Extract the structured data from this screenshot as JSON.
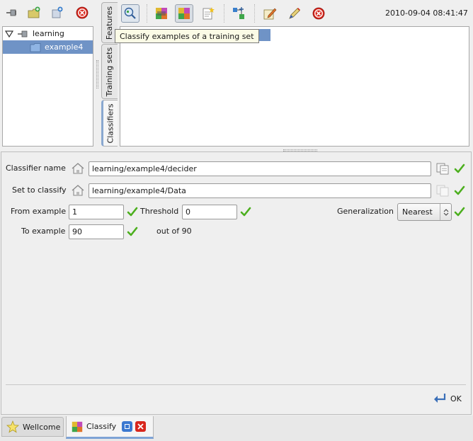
{
  "toolbar_left": {
    "icons": [
      "back-plug-icon",
      "new-folder-icon",
      "new-item-icon",
      "close-red-icon"
    ]
  },
  "tree": {
    "root_label": "learning",
    "child_label": "example4"
  },
  "vertical_tabs": {
    "features": "Features",
    "training_sets": "Training sets",
    "classifiers": "Classifiers"
  },
  "toolbar_right": {
    "timestamp": "2010-09-04 08:41:47",
    "tooltip": "Classify examples of a training set"
  },
  "form": {
    "classifier_name_label": "Classifier name",
    "classifier_name_value": "learning/example4/decider",
    "set_to_classify_label": "Set to classify",
    "set_to_classify_value": "learning/example4/Data",
    "from_example_label": "From example",
    "from_example_value": "1",
    "threshold_label": "Threshold",
    "threshold_value": "0",
    "generalization_label": "Generalization",
    "generalization_value": "Nearest",
    "to_example_label": "To example",
    "to_example_value": "90",
    "out_of_text": "out of 90"
  },
  "ok_button": "OK",
  "bottom_tabs": {
    "wellcome": "Wellcome",
    "classify": "Classify"
  },
  "colors": {
    "selection": "#6f93c6",
    "check_green": "#4caf1e",
    "close_red": "#d8261c"
  }
}
